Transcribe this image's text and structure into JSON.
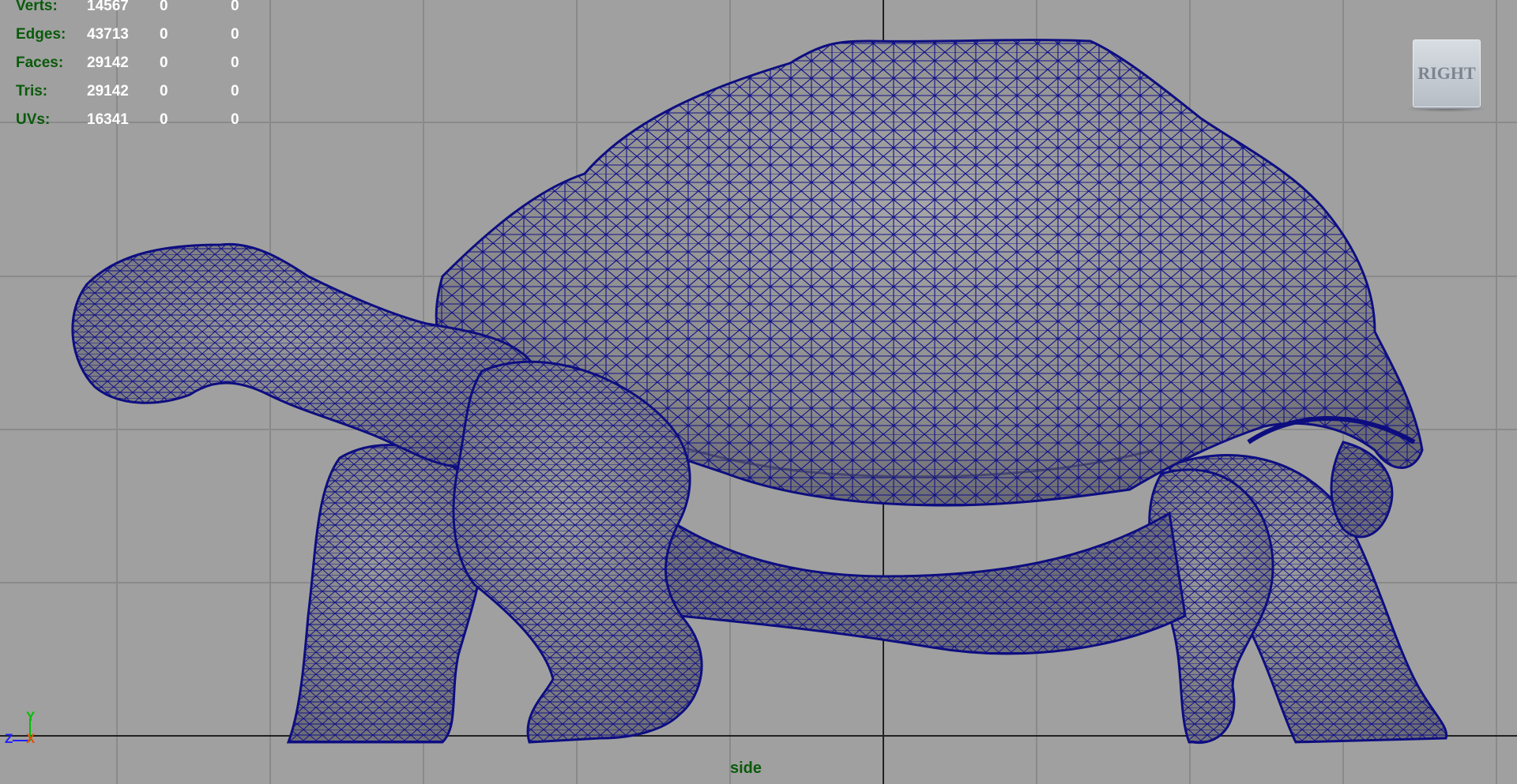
{
  "hud": {
    "rows": [
      {
        "label": "Verts:",
        "v1": "14567",
        "v2": "0",
        "v3": "0"
      },
      {
        "label": "Edges:",
        "v1": "43713",
        "v2": "0",
        "v3": "0"
      },
      {
        "label": "Faces:",
        "v1": "29142",
        "v2": "0",
        "v3": "0"
      },
      {
        "label": "Tris:",
        "v1": "29142",
        "v2": "0",
        "v3": "0"
      },
      {
        "label": "UVs:",
        "v1": "16341",
        "v2": "0",
        "v3": "0"
      }
    ]
  },
  "view_cube": {
    "face_label": "RIGHT"
  },
  "camera": {
    "name": "side"
  },
  "axis_gizmo": {
    "y": "Y",
    "z": "Z",
    "x": "X"
  },
  "colors": {
    "background": "#a0a0a0",
    "grid": "#8a8a8a",
    "grid_axis": "#202020",
    "wireframe": "#0d0d80",
    "mesh_fill": "#8a8a8a",
    "hud_label": "#0a5a0a",
    "hud_value": "#ffffff"
  },
  "icons": {
    "view_cube": "view-cube-icon",
    "axis": "axis-gizmo-icon"
  }
}
